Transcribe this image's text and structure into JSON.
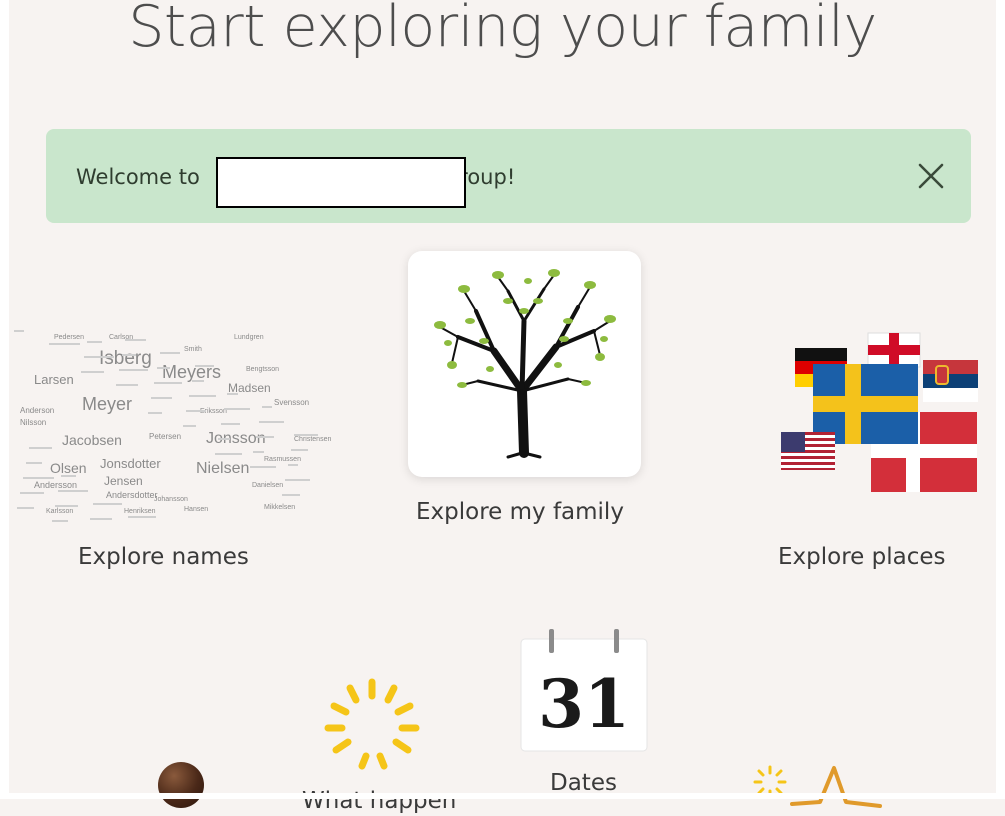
{
  "page": {
    "title": "Start exploring your family"
  },
  "welcome_banner": {
    "text_before": "Welcome to",
    "text_after": "group!",
    "background_color": "#c9e6cc",
    "close_icon": "close-icon"
  },
  "cards": {
    "names": {
      "label": "Explore names"
    },
    "family": {
      "label": "Explore my family"
    },
    "places": {
      "label": "Explore places"
    },
    "dates": {
      "label": "Dates",
      "calendar_day": "31"
    },
    "partial": {
      "label": "What happen"
    }
  },
  "name_cloud": {
    "words": [
      "Isberg",
      "Meyers",
      "Larsen",
      "Madsen",
      "Meyer",
      "Jacobsen",
      "Jonsson",
      "Olsen",
      "Jonsdotter",
      "Nielsen",
      "Jensen",
      "Andersson",
      "Andersdotter",
      "Anderson",
      "Pedersen",
      "Carlson",
      "Smith",
      "Lundgren",
      "Bengtsson",
      "Svensson",
      "Christensen",
      "Rasmussen",
      "Danielsen",
      "Henriksen",
      "Hansen",
      "Karlsson",
      "Petersen",
      "Johansson",
      "Mikkelsen",
      "Nilsson",
      "Eriksson"
    ]
  },
  "flags": [
    "germany-flag",
    "england-flag",
    "serbia-flag",
    "sweden-flag",
    "usa-flag",
    "denmark-flag"
  ],
  "colors": {
    "page_background": "#f7f3f1",
    "sun_yellow": "#f5c518"
  }
}
